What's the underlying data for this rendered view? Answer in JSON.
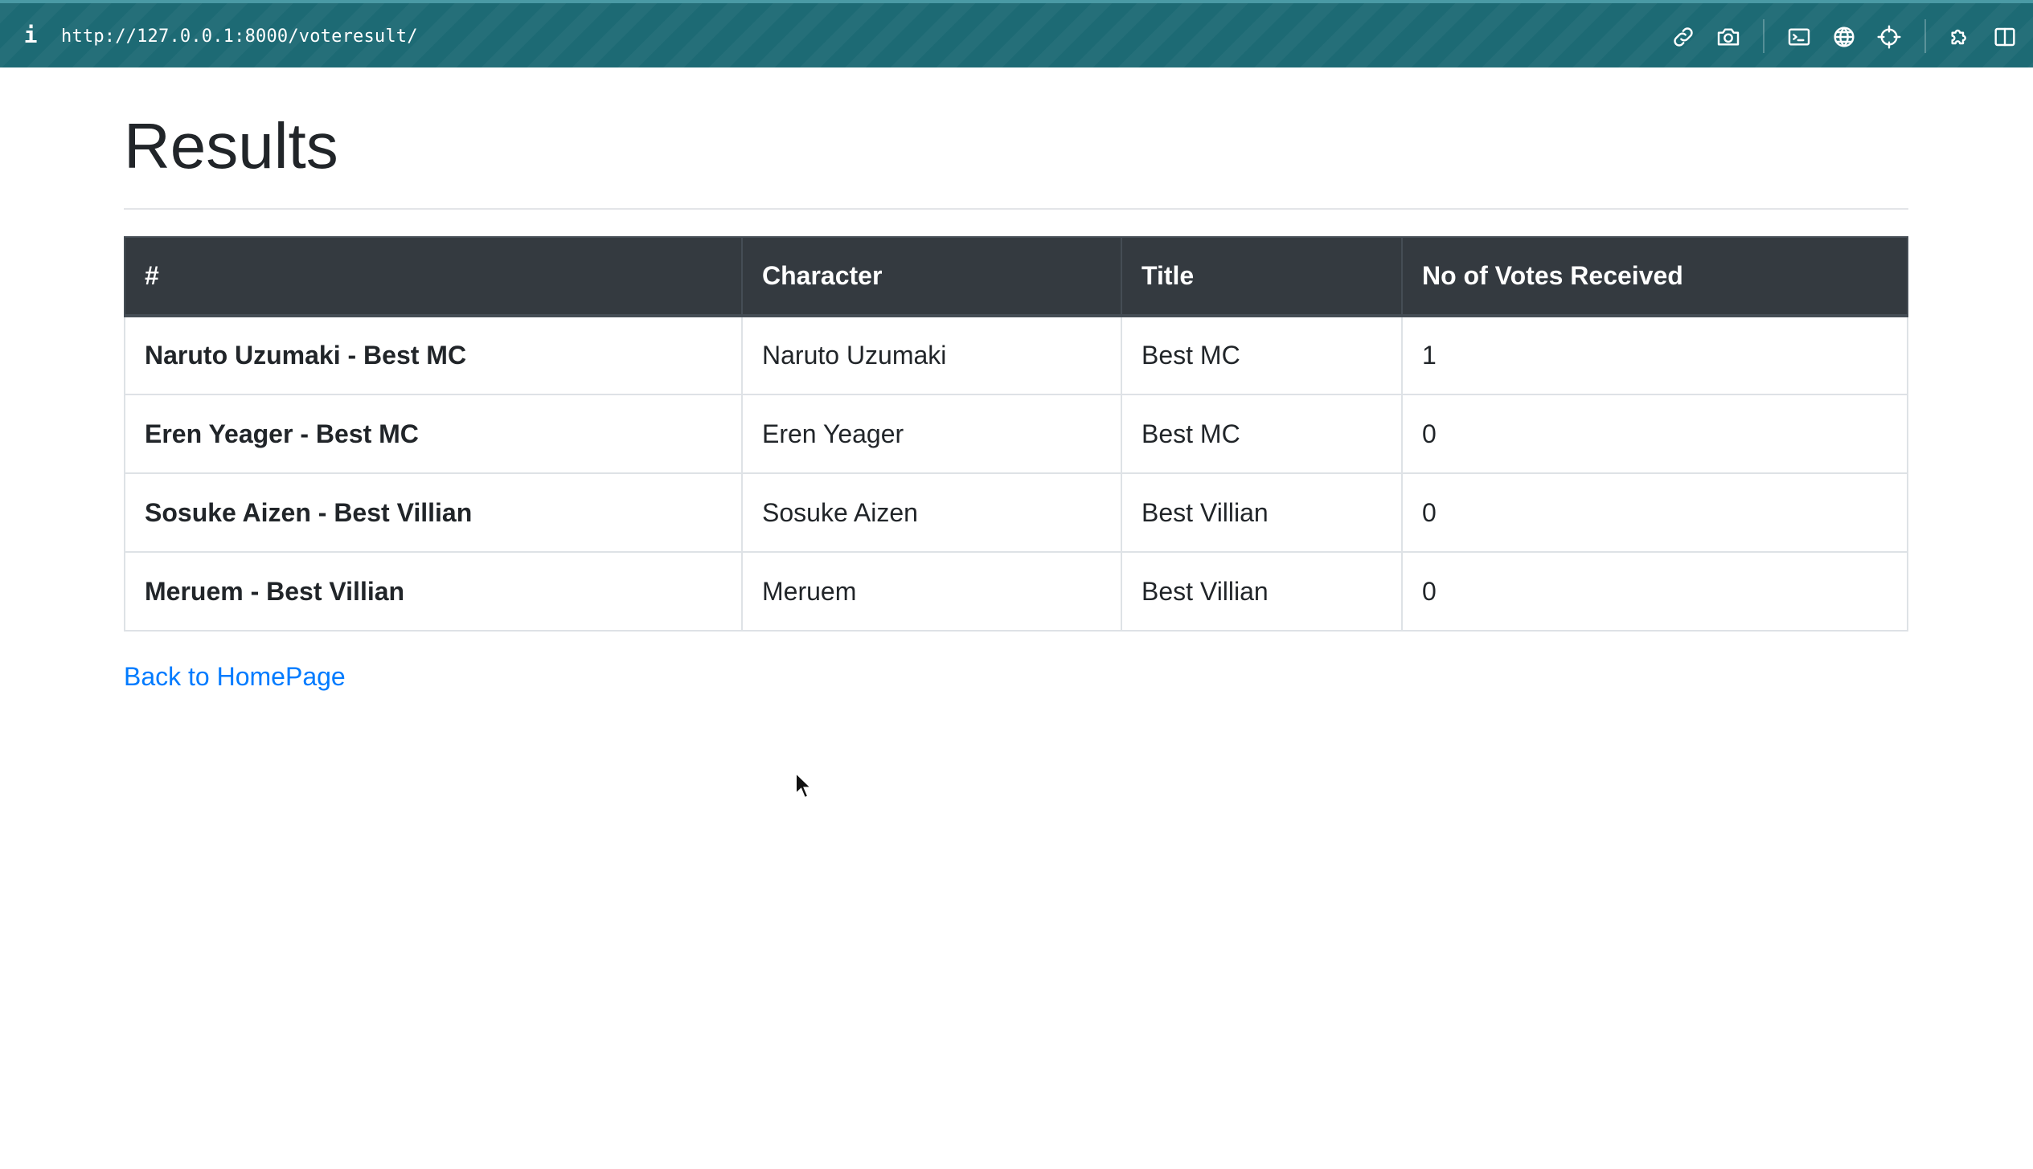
{
  "browser": {
    "info_glyph": "i",
    "url": "http://127.0.0.1:8000/voteresult/",
    "toolbar_icons": [
      "link-icon",
      "camera-icon",
      "terminal-icon",
      "globe-icon",
      "crosshair-icon",
      "extensions-icon",
      "sidebar-icon"
    ]
  },
  "page": {
    "title": "Results",
    "back_link": "Back to HomePage"
  },
  "table": {
    "headers": [
      "#",
      "Character",
      "Title",
      "No of Votes Received"
    ],
    "rows": [
      {
        "name": "Naruto Uzumaki - Best MC",
        "character": "Naruto Uzumaki",
        "title": "Best MC",
        "votes": "1"
      },
      {
        "name": "Eren Yeager - Best MC",
        "character": "Eren Yeager",
        "title": "Best MC",
        "votes": "0"
      },
      {
        "name": "Sosuke Aizen - Best Villian",
        "character": "Sosuke Aizen",
        "title": "Best Villian",
        "votes": "0"
      },
      {
        "name": "Meruem - Best Villian",
        "character": "Meruem",
        "title": "Best Villian",
        "votes": "0"
      }
    ]
  },
  "colors": {
    "browser_bar": "#1d6a74",
    "table_header": "#343a40",
    "link": "#007bff",
    "text": "#212529"
  }
}
